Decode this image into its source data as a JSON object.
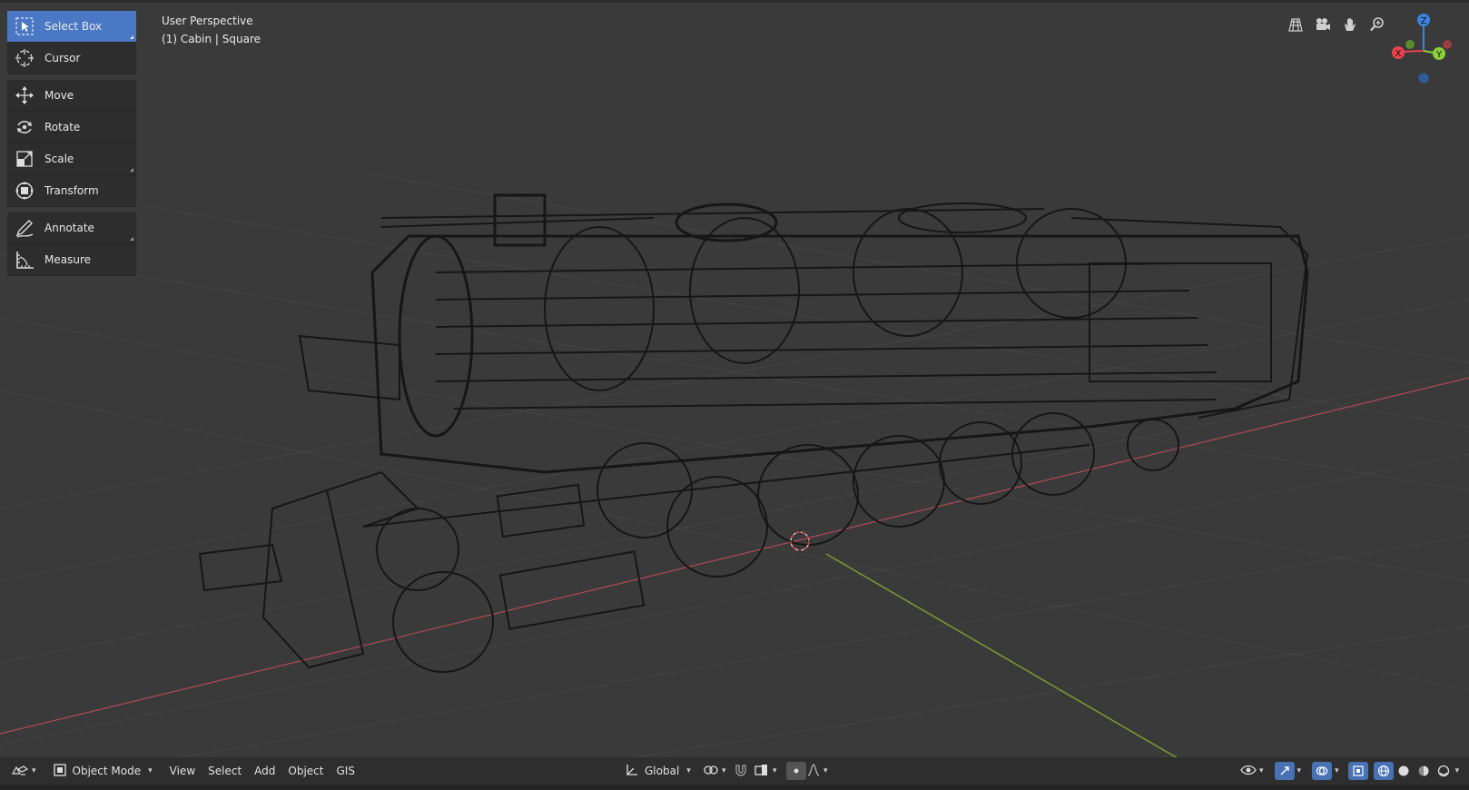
{
  "viewport": {
    "view_name": "User Perspective",
    "active_object": "(1) Cabin | Square"
  },
  "toolbar": {
    "tools": [
      {
        "label": "Select Box",
        "icon": "select-box-icon",
        "active": true
      },
      {
        "label": "Cursor",
        "icon": "cursor-icon",
        "active": false
      },
      {
        "label": "Move",
        "icon": "move-icon",
        "active": false
      },
      {
        "label": "Rotate",
        "icon": "rotate-icon",
        "active": false
      },
      {
        "label": "Scale",
        "icon": "scale-icon",
        "active": false
      },
      {
        "label": "Transform",
        "icon": "transform-icon",
        "active": false
      },
      {
        "label": "Annotate",
        "icon": "annotate-icon",
        "active": false
      },
      {
        "label": "Measure",
        "icon": "measure-icon",
        "active": false
      }
    ]
  },
  "navigation": {
    "buttons": [
      "toggle-camera-view-icon",
      "camera-icon",
      "pan-hand-icon",
      "zoom-icon"
    ],
    "gizmo": {
      "x": "X",
      "y": "Y",
      "z": "Z"
    }
  },
  "header": {
    "editor_type_icon": "3d-viewport-icon",
    "mode": "Object Mode",
    "menus": [
      "View",
      "Select",
      "Add",
      "Object",
      "GIS"
    ],
    "orientation": "Global",
    "pivot_icon": "pivot-icon",
    "snap_icon": "snap-magnet-icon",
    "proportional_icon": "proportional-edit-icon"
  },
  "colors": {
    "background": "#3a3a3a",
    "active_tool": "#4b78c4",
    "x_axis": "#e8434f",
    "y_axis": "#8ccf3a",
    "z_axis": "#3c84e0",
    "wire": "#1c1c1c"
  }
}
